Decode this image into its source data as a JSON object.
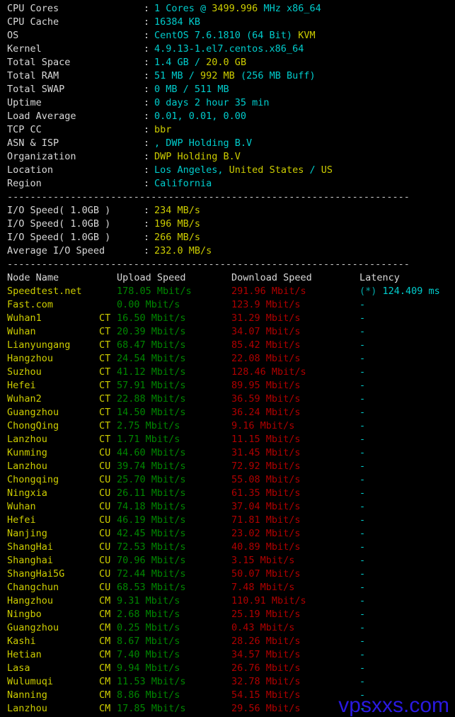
{
  "system_info": [
    {
      "label": "CPU Cores",
      "segments": [
        {
          "t": "1 Cores @ ",
          "c": "cyan"
        },
        {
          "t": "3499.996",
          "c": "yellow"
        },
        {
          "t": " MHz ",
          "c": "cyan"
        },
        {
          "t": "x86_64",
          "c": "cyan"
        }
      ]
    },
    {
      "label": "CPU Cache",
      "segments": [
        {
          "t": "16384 KB",
          "c": "cyan"
        }
      ]
    },
    {
      "label": "OS",
      "segments": [
        {
          "t": "CentOS 7.6.1810 (64 Bit) ",
          "c": "cyan"
        },
        {
          "t": "KVM",
          "c": "yellow"
        }
      ]
    },
    {
      "label": "Kernel",
      "segments": [
        {
          "t": "4.9.13-1.el7.centos.x86_64",
          "c": "cyan"
        }
      ]
    },
    {
      "label": "Total Space",
      "segments": [
        {
          "t": "1.4 GB ",
          "c": "cyan"
        },
        {
          "t": "/ ",
          "c": "cyan"
        },
        {
          "t": "20.0 GB",
          "c": "yellow"
        }
      ]
    },
    {
      "label": "Total RAM",
      "segments": [
        {
          "t": "51 MB ",
          "c": "cyan"
        },
        {
          "t": "/ ",
          "c": "cyan"
        },
        {
          "t": "992 MB ",
          "c": "yellow"
        },
        {
          "t": "(256 MB Buff)",
          "c": "cyan"
        }
      ]
    },
    {
      "label": "Total SWAP",
      "segments": [
        {
          "t": "0 MB / 511 MB",
          "c": "cyan"
        }
      ]
    },
    {
      "label": "Uptime",
      "segments": [
        {
          "t": "0 days 2 hour 35 min",
          "c": "cyan"
        }
      ]
    },
    {
      "label": "Load Average",
      "segments": [
        {
          "t": "0.01, 0.01, 0.00",
          "c": "cyan"
        }
      ]
    },
    {
      "label": "TCP CC",
      "segments": [
        {
          "t": "bbr",
          "c": "yellow"
        }
      ]
    },
    {
      "label": "ASN & ISP",
      "segments": [
        {
          "t": ", DWP Holding B.V",
          "c": "cyan"
        }
      ]
    },
    {
      "label": "Organization",
      "segments": [
        {
          "t": "DWP Holding B.V",
          "c": "yellow"
        }
      ]
    },
    {
      "label": "Location",
      "segments": [
        {
          "t": "Los Angeles, ",
          "c": "cyan"
        },
        {
          "t": "United States ",
          "c": "yellow"
        },
        {
          "t": "/ ",
          "c": "cyan"
        },
        {
          "t": "US",
          "c": "yellow"
        }
      ]
    },
    {
      "label": "Region",
      "segments": [
        {
          "t": "California",
          "c": "cyan"
        }
      ]
    }
  ],
  "io_tests": [
    {
      "label": "I/O Speed( 1.0GB )",
      "value": "234 MB/s"
    },
    {
      "label": "I/O Speed( 1.0GB )",
      "value": "196 MB/s"
    },
    {
      "label": "I/O Speed( 1.0GB )",
      "value": "266 MB/s"
    },
    {
      "label": "Average I/O Speed",
      "value": "232.0 MB/s"
    }
  ],
  "separator": "----------------------------------------------------------------------",
  "node_table": {
    "headers": {
      "node_name": "Node Name",
      "upload_speed": "Upload Speed",
      "download_speed": "Download Speed",
      "latency": "Latency"
    },
    "rows": [
      {
        "name": "Speedtest.net",
        "isp": "",
        "upload": "178.05 Mbit/s",
        "download": "291.96 Mbit/s",
        "latency_mark": "(*) ",
        "latency": "124.409 ms"
      },
      {
        "name": "Fast.com",
        "isp": "",
        "upload": "0.00 Mbit/s",
        "download": "123.9 Mbit/s",
        "latency_mark": "",
        "latency": "-"
      },
      {
        "name": "Wuhan1",
        "isp": "CT",
        "upload": "16.50 Mbit/s",
        "download": "31.29 Mbit/s",
        "latency_mark": "",
        "latency": "-"
      },
      {
        "name": "Wuhan",
        "isp": "CT",
        "upload": "20.39 Mbit/s",
        "download": "34.07 Mbit/s",
        "latency_mark": "",
        "latency": "-"
      },
      {
        "name": "Lianyungang",
        "isp": "CT",
        "upload": "68.47 Mbit/s",
        "download": "85.42 Mbit/s",
        "latency_mark": "",
        "latency": "-"
      },
      {
        "name": "Hangzhou",
        "isp": "CT",
        "upload": "24.54 Mbit/s",
        "download": "22.08 Mbit/s",
        "latency_mark": "",
        "latency": "-"
      },
      {
        "name": "Suzhou",
        "isp": "CT",
        "upload": "41.12 Mbit/s",
        "download": "128.46 Mbit/s",
        "latency_mark": "",
        "latency": "-"
      },
      {
        "name": "Hefei",
        "isp": "CT",
        "upload": "57.91 Mbit/s",
        "download": "89.95 Mbit/s",
        "latency_mark": "",
        "latency": "-"
      },
      {
        "name": "Wuhan2",
        "isp": "CT",
        "upload": "22.88 Mbit/s",
        "download": "36.59 Mbit/s",
        "latency_mark": "",
        "latency": "-"
      },
      {
        "name": "Guangzhou",
        "isp": "CT",
        "upload": "14.50 Mbit/s",
        "download": "36.24 Mbit/s",
        "latency_mark": "",
        "latency": "-"
      },
      {
        "name": "ChongQing",
        "isp": "CT",
        "upload": "2.75 Mbit/s",
        "download": "9.16 Mbit/s",
        "latency_mark": "",
        "latency": "-"
      },
      {
        "name": "Lanzhou",
        "isp": "CT",
        "upload": "1.71 Mbit/s",
        "download": "11.15 Mbit/s",
        "latency_mark": "",
        "latency": "-"
      },
      {
        "name": "Kunming",
        "isp": "CU",
        "upload": "44.60 Mbit/s",
        "download": "31.45 Mbit/s",
        "latency_mark": "",
        "latency": "-"
      },
      {
        "name": "Lanzhou",
        "isp": "CU",
        "upload": "39.74 Mbit/s",
        "download": "72.92 Mbit/s",
        "latency_mark": "",
        "latency": "-"
      },
      {
        "name": "Chongqing",
        "isp": "CU",
        "upload": "25.70 Mbit/s",
        "download": "55.08 Mbit/s",
        "latency_mark": "",
        "latency": "-"
      },
      {
        "name": "Ningxia",
        "isp": "CU",
        "upload": "26.11 Mbit/s",
        "download": "61.35 Mbit/s",
        "latency_mark": "",
        "latency": "-"
      },
      {
        "name": "Wuhan",
        "isp": "CU",
        "upload": "74.18 Mbit/s",
        "download": "37.04 Mbit/s",
        "latency_mark": "",
        "latency": "-"
      },
      {
        "name": "Hefei",
        "isp": "CU",
        "upload": "46.19 Mbit/s",
        "download": "71.81 Mbit/s",
        "latency_mark": "",
        "latency": "-"
      },
      {
        "name": "Nanjing",
        "isp": "CU",
        "upload": "42.45 Mbit/s",
        "download": "23.02 Mbit/s",
        "latency_mark": "",
        "latency": "-"
      },
      {
        "name": "ShangHai",
        "isp": "CU",
        "upload": "72.53 Mbit/s",
        "download": "40.89 Mbit/s",
        "latency_mark": "",
        "latency": "-"
      },
      {
        "name": "Shanghai",
        "isp": "CU",
        "upload": "70.96 Mbit/s",
        "download": "3.15 Mbit/s",
        "latency_mark": "",
        "latency": "-"
      },
      {
        "name": "ShangHai5G",
        "isp": "CU",
        "upload": "72.44 Mbit/s",
        "download": "50.07 Mbit/s",
        "latency_mark": "",
        "latency": "-"
      },
      {
        "name": "Changchun",
        "isp": "CU",
        "upload": "68.53 Mbit/s",
        "download": "7.48 Mbit/s",
        "latency_mark": "",
        "latency": "-"
      },
      {
        "name": "Hangzhou",
        "isp": "CM",
        "upload": "9.31 Mbit/s",
        "download": "110.91 Mbit/s",
        "latency_mark": "",
        "latency": "-"
      },
      {
        "name": "Ningbo",
        "isp": "CM",
        "upload": "2.68 Mbit/s",
        "download": "25.19 Mbit/s",
        "latency_mark": "",
        "latency": "-"
      },
      {
        "name": "Guangzhou",
        "isp": "CM",
        "upload": "0.25 Mbit/s",
        "download": "0.43 Mbit/s",
        "latency_mark": "",
        "latency": "-"
      },
      {
        "name": "Kashi",
        "isp": "CM",
        "upload": "8.67 Mbit/s",
        "download": "28.26 Mbit/s",
        "latency_mark": "",
        "latency": "-"
      },
      {
        "name": "Hetian",
        "isp": "CM",
        "upload": "7.40 Mbit/s",
        "download": "34.57 Mbit/s",
        "latency_mark": "",
        "latency": "-"
      },
      {
        "name": "Lasa",
        "isp": "CM",
        "upload": "9.94 Mbit/s",
        "download": "26.76 Mbit/s",
        "latency_mark": "",
        "latency": "-"
      },
      {
        "name": "Wulumuqi",
        "isp": "CM",
        "upload": "11.53 Mbit/s",
        "download": "32.78 Mbit/s",
        "latency_mark": "",
        "latency": "-"
      },
      {
        "name": "Nanning",
        "isp": "CM",
        "upload": "8.86 Mbit/s",
        "download": "54.15 Mbit/s",
        "latency_mark": "",
        "latency": "-"
      },
      {
        "name": "Lanzhou",
        "isp": "CM",
        "upload": "17.85 Mbit/s",
        "download": "29.56 Mbit/s",
        "latency_mark": "",
        "latency": "-"
      }
    ]
  },
  "watermark": "vpsxxs.com",
  "colors": {
    "background": "#000000",
    "label": "#d8d8d8",
    "cyan": "#00cdcd",
    "yellow": "#cdcd00",
    "green": "#008700",
    "red": "#b00000",
    "watermark": "#2a19e0"
  }
}
